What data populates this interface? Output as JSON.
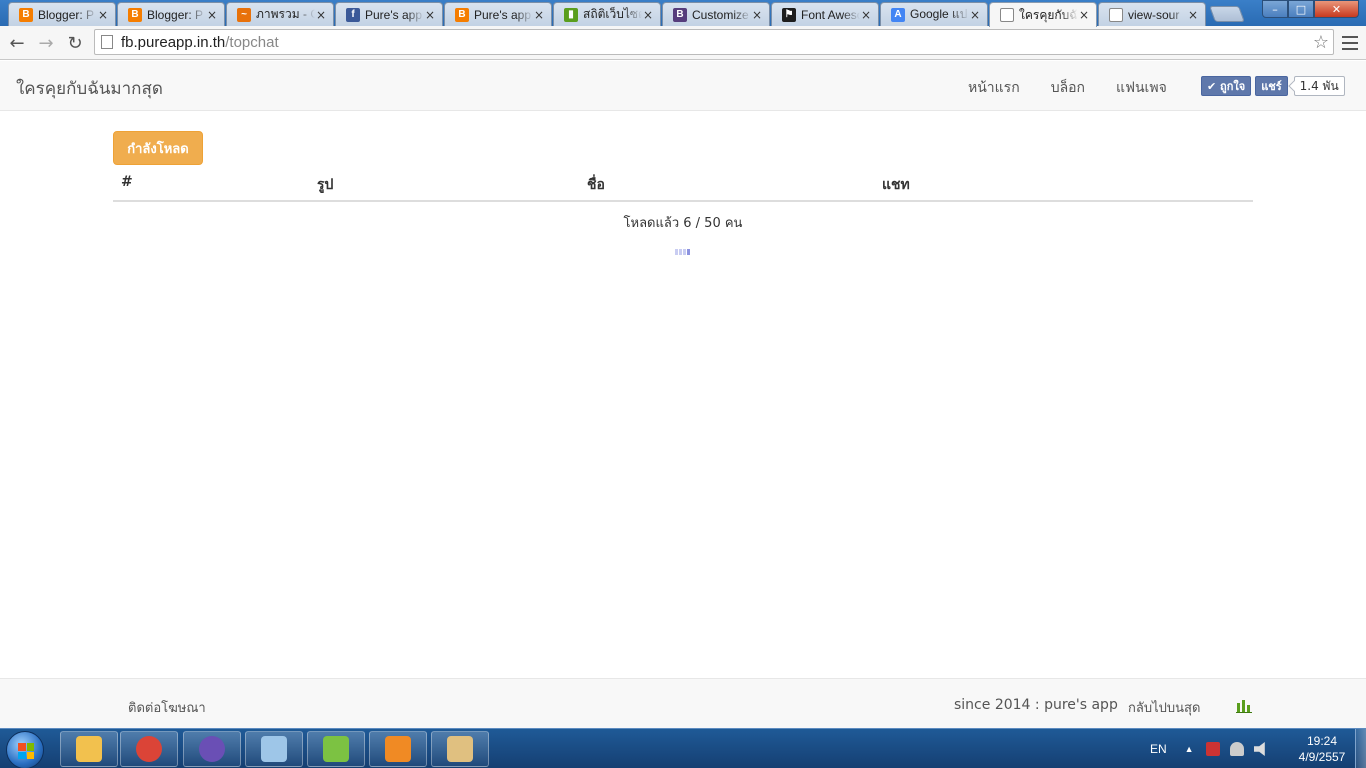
{
  "browser": {
    "tabs": [
      {
        "title": "Blogger: P",
        "icon": "blogger-icon",
        "color": "#f57d00",
        "glyph": "B"
      },
      {
        "title": "Blogger: P",
        "icon": "blogger-icon",
        "color": "#f57d00",
        "glyph": "B"
      },
      {
        "title": "ภาพรวม - G",
        "icon": "analytics-icon",
        "color": "#e8710a",
        "glyph": "~"
      },
      {
        "title": "Pure's app",
        "icon": "facebook-icon",
        "color": "#3b5998",
        "glyph": "f"
      },
      {
        "title": "Pure's app",
        "icon": "blogger-icon",
        "color": "#f57d00",
        "glyph": "B"
      },
      {
        "title": "สถิติเว็บไซต์",
        "icon": "stats-icon",
        "color": "#5a9e1d",
        "glyph": "▮"
      },
      {
        "title": "Customize",
        "icon": "bootstrap-icon",
        "color": "#563d7c",
        "glyph": "B"
      },
      {
        "title": "Font Aweso",
        "icon": "flag-icon",
        "color": "#1d1d1d",
        "glyph": "⚑"
      },
      {
        "title": "Google แป",
        "icon": "translate-icon",
        "color": "#4285f4",
        "glyph": "A"
      },
      {
        "title": "ใครคุยกับฉั",
        "icon": "page-icon",
        "color": "#ffffff",
        "glyph": ""
      },
      {
        "title": "view-sour",
        "icon": "page-icon",
        "color": "#ffffff",
        "glyph": ""
      }
    ],
    "active_tab": 9,
    "close_glyph": "×",
    "url_host": "fb.pureapp.in.th",
    "url_path": "/topchat",
    "back_glyph": "←",
    "forward_glyph": "→",
    "reload_glyph": "↻",
    "star_glyph": "☆",
    "window_min": "–",
    "window_max": "□",
    "window_close": "✕"
  },
  "navbar": {
    "brand": "ใครคุยกับฉันมากสุด",
    "links": [
      "หน้าแรก",
      "บล็อก",
      "แฟนเพจ"
    ],
    "fb_like": "✔ ถูกใจ",
    "fb_share": "แชร์",
    "fb_count": "1.4 พัน"
  },
  "main": {
    "loading_button": "กำลังโหลด",
    "columns": [
      "#",
      "รูป",
      "ชื่อ",
      "แชท"
    ],
    "progress_text": "โหลดแล้ว 6 / 50 คน"
  },
  "footer": {
    "contact": "ติดต่อโฆษณา",
    "since": "since 2014 : pure's app",
    "back_to_top": "กลับไปบนสุด"
  },
  "taskbar": {
    "apps": [
      {
        "name": "explorer",
        "icon": "folder-icon",
        "color": "#f2c14e"
      },
      {
        "name": "chrome",
        "icon": "chrome-icon",
        "color": "#db4437"
      },
      {
        "name": "app-cat",
        "icon": "cat-icon",
        "color": "#6a4fb5"
      },
      {
        "name": "notepad",
        "icon": "notepad-icon",
        "color": "#9ec6e8"
      },
      {
        "name": "notepad-plus",
        "icon": "notepadpp-icon",
        "color": "#7cc242"
      },
      {
        "name": "media-player",
        "icon": "media-player-icon",
        "color": "#f08a24"
      },
      {
        "name": "paint",
        "icon": "paint-icon",
        "color": "#e0c080"
      }
    ],
    "lang": "EN",
    "tray_arrow": "▲",
    "time": "19:24",
    "date": "4/9/2557"
  },
  "colors": {
    "warning": "#f0ad4e",
    "facebook": "#5f78ab"
  }
}
